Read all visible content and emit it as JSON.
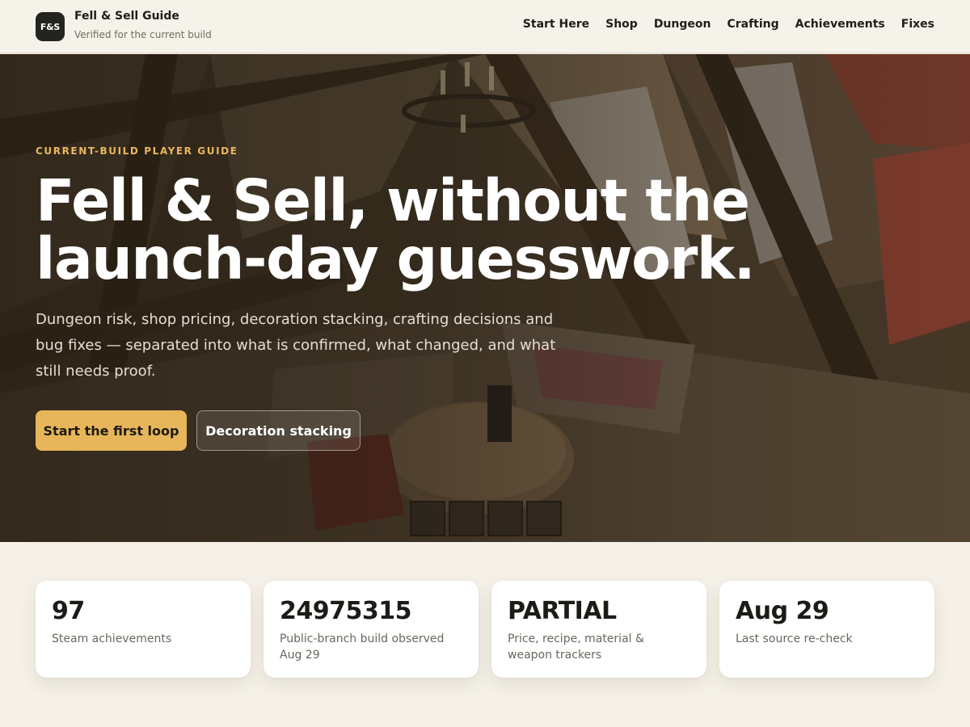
{
  "header": {
    "logo_text": "F&S",
    "brand_name": "Fell & Sell Guide",
    "tagline": "Verified for the current build",
    "nav": [
      {
        "label": "Start Here"
      },
      {
        "label": "Shop"
      },
      {
        "label": "Dungeon"
      },
      {
        "label": "Crafting"
      },
      {
        "label": "Achievements"
      },
      {
        "label": "Fixes"
      }
    ]
  },
  "hero": {
    "eyebrow": "CURRENT-BUILD PLAYER GUIDE",
    "title_line1": "Fell & Sell, without the",
    "title_line2": "launch-day guesswork.",
    "lead": "Dungeon risk, shop pricing, decoration stacking, crafting decisions and bug fixes — separated into what is confirmed, what changed, and what still needs proof.",
    "primary_cta": "Start the first loop",
    "secondary_cta": "Decoration stacking"
  },
  "stats": [
    {
      "value": "97",
      "label": "Steam achievements"
    },
    {
      "value": "24975315",
      "label": "Public-branch build observed Aug 29"
    },
    {
      "value": "PARTIAL",
      "label": "Price, recipe, material & weapon trackers"
    },
    {
      "value": "Aug 29",
      "label": "Last source re-check"
    }
  ],
  "colors": {
    "accent": "#e8b65a",
    "eyebrow": "#e9b75e",
    "page_bg": "#f5f1e8",
    "logo_bg": "#23231f"
  }
}
